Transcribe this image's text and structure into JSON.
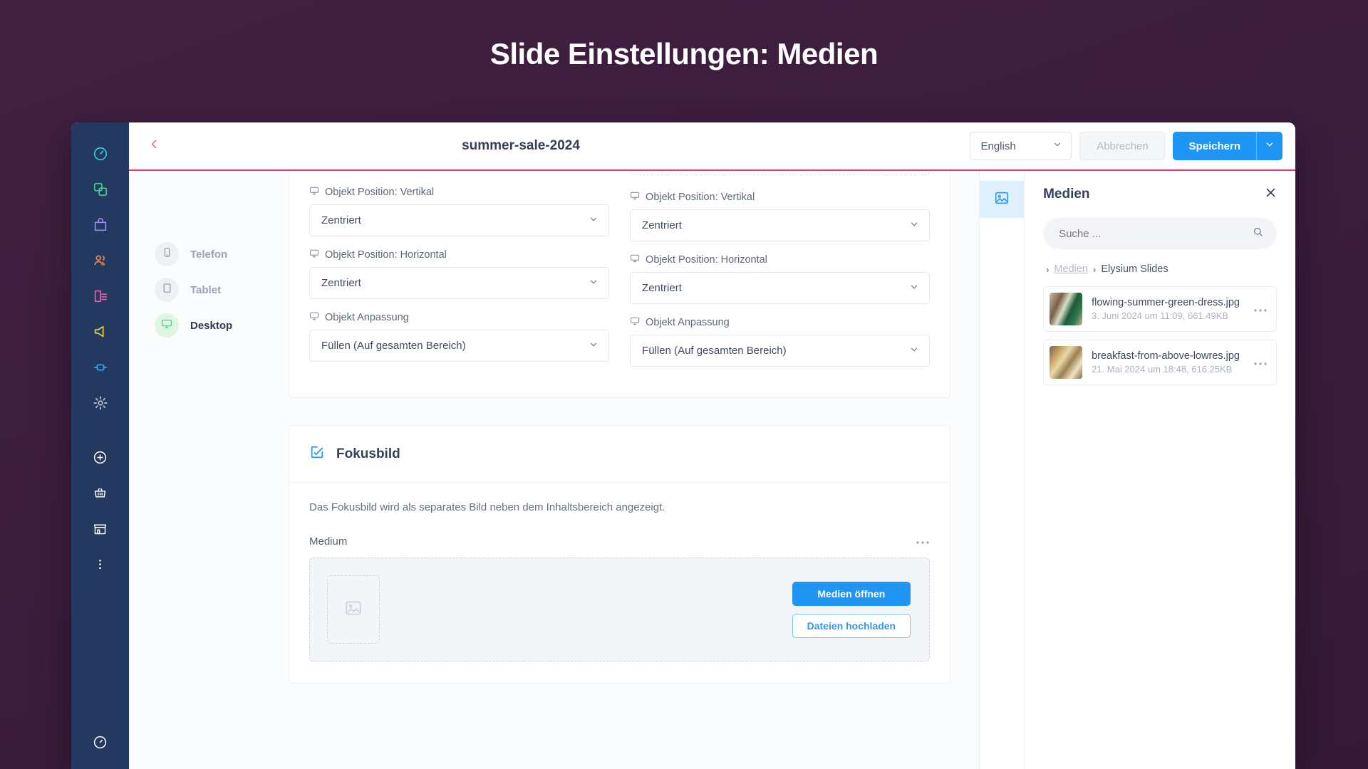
{
  "page": {
    "title": "Slide Einstellungen: Medien"
  },
  "topbar": {
    "document_title": "summer-sale-2024",
    "back_icon": "chevron-left-icon",
    "language": "English",
    "cancel_label": "Abbrechen",
    "save_label": "Speichern"
  },
  "sidebar": {
    "items": [
      {
        "name": "dashboard-icon",
        "color": "#2fd0d8"
      },
      {
        "name": "layers-icon",
        "color": "#3ecf8e"
      },
      {
        "name": "shopping-bag-icon",
        "color": "#9b8af7"
      },
      {
        "name": "users-icon",
        "color": "#f08a4b"
      },
      {
        "name": "content-icon",
        "color": "#ee5fa7"
      },
      {
        "name": "megaphone-icon",
        "color": "#f5d33d"
      },
      {
        "name": "plugin-icon",
        "color": "#39a7f5"
      },
      {
        "name": "settings-icon",
        "color": "#c3c9d4"
      }
    ],
    "bottom_items": [
      {
        "name": "add-circle-icon",
        "color": "#ffffff"
      },
      {
        "name": "basket-icon",
        "color": "#ffffff"
      },
      {
        "name": "store-icon",
        "color": "#ffffff"
      },
      {
        "name": "more-vertical-icon",
        "color": "#ffffff"
      }
    ],
    "footer_item": {
      "name": "help-circle-icon",
      "color": "#ffffff"
    }
  },
  "devices": [
    {
      "label": "Telefon",
      "icon": "phone-icon",
      "active": false
    },
    {
      "label": "Tablet",
      "icon": "tablet-icon",
      "active": false
    },
    {
      "label": "Desktop",
      "icon": "desktop-icon",
      "active": true
    }
  ],
  "form": {
    "columns": [
      {
        "fields": [
          {
            "label": "Objekt Position: Vertikal",
            "icon": "desktop-icon",
            "value": "Zentriert"
          },
          {
            "label": "Objekt Position: Horizontal",
            "icon": "desktop-icon",
            "value": "Zentriert"
          },
          {
            "label": "Objekt Anpassung",
            "icon": "desktop-icon",
            "value": "Füllen (Auf gesamten Bereich)"
          }
        ]
      },
      {
        "fields": [
          {
            "label": "Objekt Position: Vertikal",
            "icon": "desktop-icon",
            "value": "Zentriert"
          },
          {
            "label": "Objekt Position: Horizontal",
            "icon": "desktop-icon",
            "value": "Zentriert"
          },
          {
            "label": "Objekt Anpassung",
            "icon": "desktop-icon",
            "value": "Füllen (Auf gesamten Bereich)"
          }
        ]
      }
    ]
  },
  "focus_image": {
    "title": "Fokusbild",
    "icon": "focus-image-icon",
    "description": "Das Fokusbild wird als separates Bild neben dem Inhaltsbereich angezeigt.",
    "medium_label": "Medium",
    "more_icon": "ellipsis-icon",
    "placeholder_icon": "image-placeholder-icon",
    "open_media_label": "Medien öffnen",
    "upload_label": "Dateien hochladen"
  },
  "media_panel": {
    "tab_icon": "image-icon",
    "title": "Medien",
    "close_icon": "close-icon",
    "search_placeholder": "Suche ...",
    "search_icon": "search-icon",
    "breadcrumb": {
      "root": "Medien",
      "current": "Elysium Slides"
    },
    "items": [
      {
        "name": "flowing-summer-green-dress.jpg",
        "meta": "3. Juni 2024 um 11:09, 661.49KB",
        "more_icon": "ellipsis-icon"
      },
      {
        "name": "breakfast-from-above-lowres.jpg",
        "meta": "21. Mai 2024 um 18:48, 616.25KB",
        "more_icon": "ellipsis-icon"
      }
    ]
  },
  "colors": {
    "backdrop": "#3c1f3f",
    "rail": "#23395f",
    "accent_pink": "#e8356d",
    "primary_blue": "#1f96f3",
    "active_green": "#3ecf8e"
  }
}
